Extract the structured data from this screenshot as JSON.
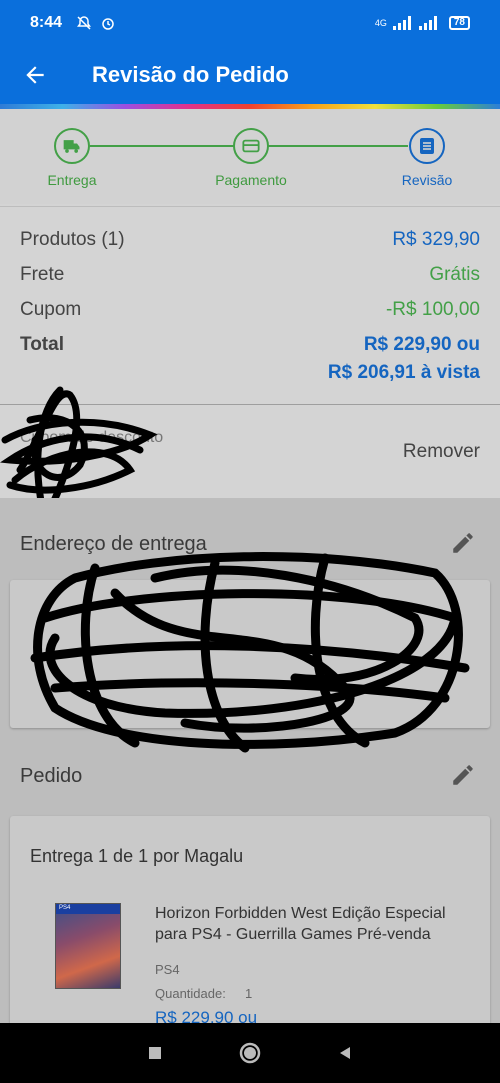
{
  "status": {
    "time": "8:44",
    "network": "4G",
    "battery": "78"
  },
  "appbar": {
    "title": "Revisão do Pedido"
  },
  "steps": [
    {
      "label": "Entrega"
    },
    {
      "label": "Pagamento"
    },
    {
      "label": "Revisão"
    }
  ],
  "summary": {
    "produtos_label": "Produtos (1)",
    "produtos_value": "R$ 329,90",
    "frete_label": "Frete",
    "frete_value": "Grátis",
    "cupom_label": "Cupom",
    "cupom_value": "-R$ 100,00",
    "total_label": "Total",
    "total_value": "R$ 229,90 ou",
    "total_vista": "R$ 206,91 à vista"
  },
  "coupon": {
    "label": "Cupom de desconto",
    "remove": "Remover"
  },
  "endereco": {
    "title": "Endereço de entrega"
  },
  "pedido": {
    "title": "Pedido",
    "delivery": "Entrega 1 de 1 por Magalu",
    "product_title": "Horizon Forbidden West Edição Especial para PS4 - Guerrilla Games Pré-venda",
    "platform": "PS4",
    "quantity_label": "Quantidade:",
    "quantity": "1",
    "price": "R$ 229,90 ou",
    "thumb_badge": "PS4"
  },
  "icons": {
    "back": "arrow-left-icon",
    "truck": "truck-icon",
    "card": "credit-card-icon",
    "list": "list-icon",
    "edit": "pencil-icon",
    "home": "home-icon",
    "recents": "recents-icon"
  },
  "colors": {
    "primary": "#0a6fdc",
    "accent_blue": "#1565c0",
    "green": "#43a047"
  }
}
